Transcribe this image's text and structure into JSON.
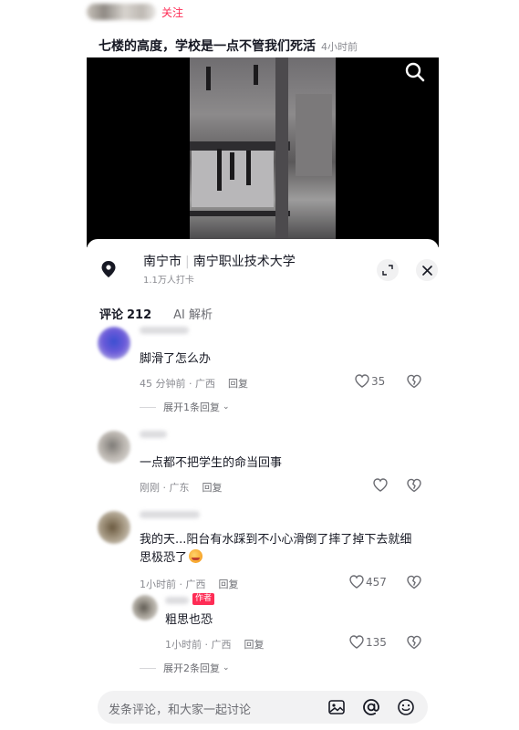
{
  "header": {
    "follow_label": "关注"
  },
  "post": {
    "title": "七楼的高度，学校是一点不管我们死活",
    "time": "4小时前"
  },
  "location": {
    "city": "南宁市",
    "place": "南宁职业技术大学",
    "checkins": "1.1万人打卡"
  },
  "tabs": [
    {
      "label": "评论",
      "count": "212"
    },
    {
      "label": "AI 解析"
    }
  ],
  "comments": [
    {
      "text": "脚滑了怎么办",
      "time": "45 分钟前",
      "region": "广西",
      "reply_label": "回复",
      "likes": "35",
      "expand": "展开1条回复"
    },
    {
      "text": "一点都不把学生的命当回事",
      "time": "刚刚",
      "region": "广东",
      "reply_label": "回复",
      "likes": ""
    },
    {
      "text": "我的天...阳台有水踩到不小心滑倒了摔了掉下去就细思极恐了",
      "time": "1小时前",
      "region": "广西",
      "reply_label": "回复",
      "likes": "457"
    }
  ],
  "reply": {
    "badge": "作者",
    "text": "粗思也恐",
    "time": "1小时前",
    "region": "广西",
    "reply_label": "回复",
    "likes": "135"
  },
  "expand_more": "展开2条回复",
  "input": {
    "placeholder": "发条评论，和大家一起讨论"
  },
  "icons": {
    "search": "search-icon",
    "pin": "location-pin-icon",
    "expand": "expand-icon",
    "close": "close-icon",
    "heart": "heart-icon",
    "dislike": "broken-heart-icon",
    "image": "image-icon",
    "mention": "at-icon",
    "emoji": "emoji-icon"
  },
  "colors": {
    "accent": "#fe2c55",
    "text": "#161823",
    "muted": "#8a8b91"
  }
}
